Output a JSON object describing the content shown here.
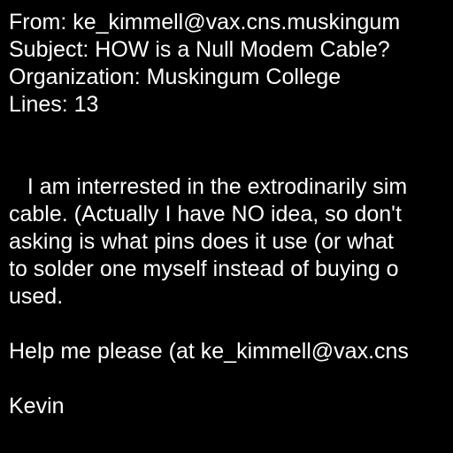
{
  "header": {
    "from": "From: ke_kimmell@vax.cns.muskingum",
    "subject": "Subject: HOW is a Null Modem Cable?",
    "organization": "Organization: Muskingum College",
    "lines": "Lines: 13"
  },
  "body": {
    "paragraph1": [
      "   I am interrested in the extrodinarily sim",
      "cable. (Actually I have NO idea, so don't",
      "asking is what pins does it use (or what",
      "to solder one myself instead of buying o",
      "used."
    ],
    "paragraph2": "Help me please (at ke_kimmell@vax.cns",
    "signature": "Kevin"
  },
  "colors": {
    "background": "#000000",
    "text": "#ffffff"
  }
}
